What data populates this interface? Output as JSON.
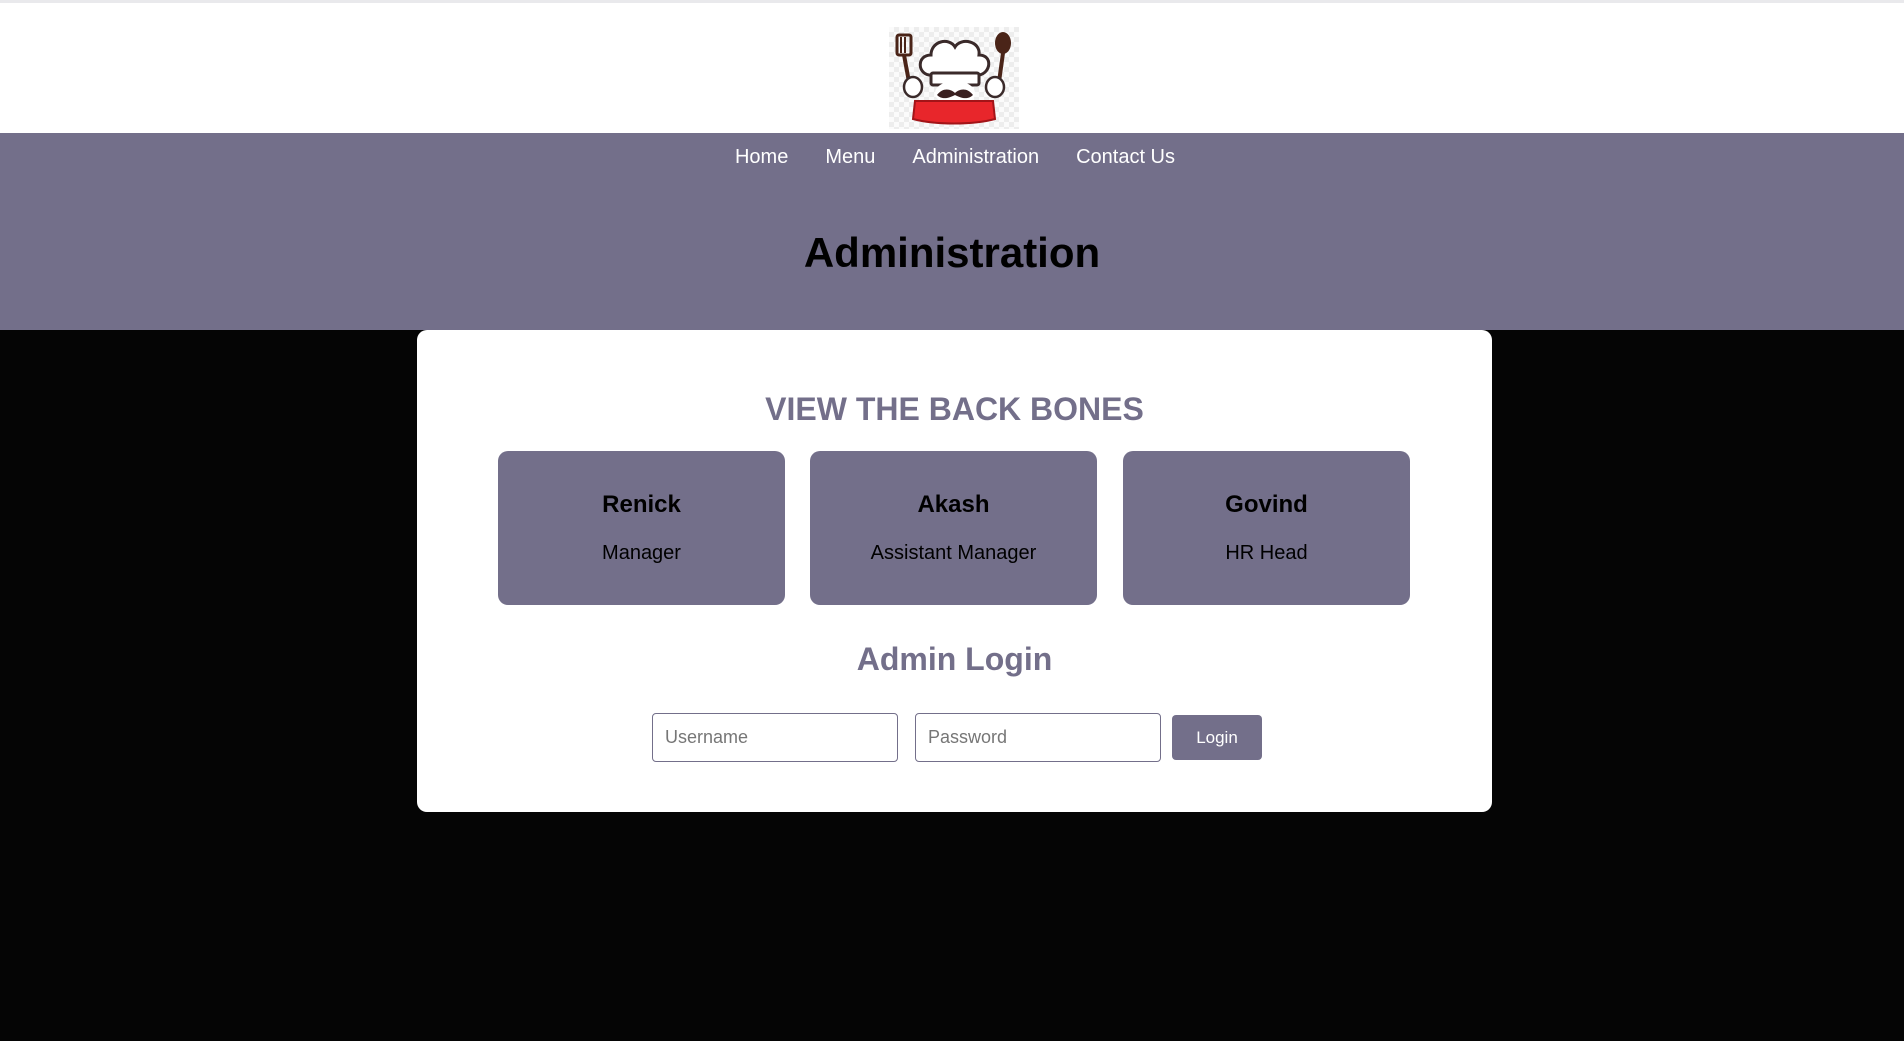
{
  "brand": {
    "logo_icon": "chef-logo-icon",
    "colors": {
      "accent": "#736f8a",
      "background": "#050505",
      "surface": "#ffffff",
      "logo_banner": "#e8262b"
    }
  },
  "nav": {
    "items": [
      {
        "label": "Home"
      },
      {
        "label": "Menu"
      },
      {
        "label": "Administration"
      },
      {
        "label": "Contact Us"
      }
    ]
  },
  "page": {
    "title": "Administration"
  },
  "staff_section": {
    "title": "VIEW THE BACK BONES",
    "members": [
      {
        "name": "Renick",
        "role": "Manager"
      },
      {
        "name": "Akash",
        "role": "Assistant Manager"
      },
      {
        "name": "Govind",
        "role": "HR Head"
      }
    ]
  },
  "login": {
    "title": "Admin Login",
    "username_placeholder": "Username",
    "username_value": "",
    "password_placeholder": "Password",
    "password_value": "",
    "button_label": "Login"
  }
}
